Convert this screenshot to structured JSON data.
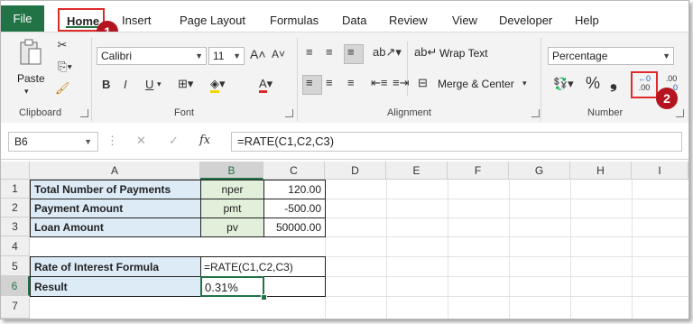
{
  "ribbon_tabs": {
    "file": "File",
    "home": "Home",
    "insert": "Insert",
    "page_layout": "Page Layout",
    "formulas": "Formulas",
    "data": "Data",
    "review": "Review",
    "view": "View",
    "developer": "Developer",
    "help": "Help"
  },
  "callouts": {
    "one": "1",
    "two": "2"
  },
  "clipboard": {
    "paste_label": "Paste",
    "group_label": "Clipboard"
  },
  "font": {
    "family": "Calibri",
    "size": "11",
    "bold": "B",
    "italic": "I",
    "underline": "U",
    "group_label": "Font"
  },
  "alignment": {
    "wrap_text": "Wrap Text",
    "merge_center": "Merge & Center",
    "group_label": "Alignment"
  },
  "number": {
    "format": "Percentage",
    "percent_symbol": "%",
    "comma_symbol": "❟",
    "increase_decimal_top": "←0",
    "increase_decimal_bottom": ".00",
    "decrease_decimal_top": ".00",
    "decrease_decimal_bottom": "→0",
    "group_label": "Number"
  },
  "formula_bar": {
    "name_box": "B6",
    "fx": "fx",
    "formula": "=RATE(C1,C2,C3)"
  },
  "columns": [
    "A",
    "B",
    "C",
    "D",
    "E",
    "F",
    "G",
    "H",
    "I"
  ],
  "rows": [
    "1",
    "2",
    "3",
    "4",
    "5",
    "6",
    "7"
  ],
  "cells": {
    "a1": "Total Number of Payments",
    "b1": "nper",
    "c1": "120.00",
    "a2": "Payment Amount",
    "b2": "pmt",
    "c2": "-500.00",
    "a3": "Loan Amount",
    "b3": "pv",
    "c3": "50000.00",
    "a5": "Rate of Interest Formula",
    "b5": "=RATE(C1,C2,C3)",
    "a6": "Result",
    "b6": "0.31%"
  },
  "colors": {
    "excel_green": "#217346",
    "label_fill": "#ddebf7",
    "input_fill": "#e2efda",
    "callout_red": "#b3141f"
  }
}
